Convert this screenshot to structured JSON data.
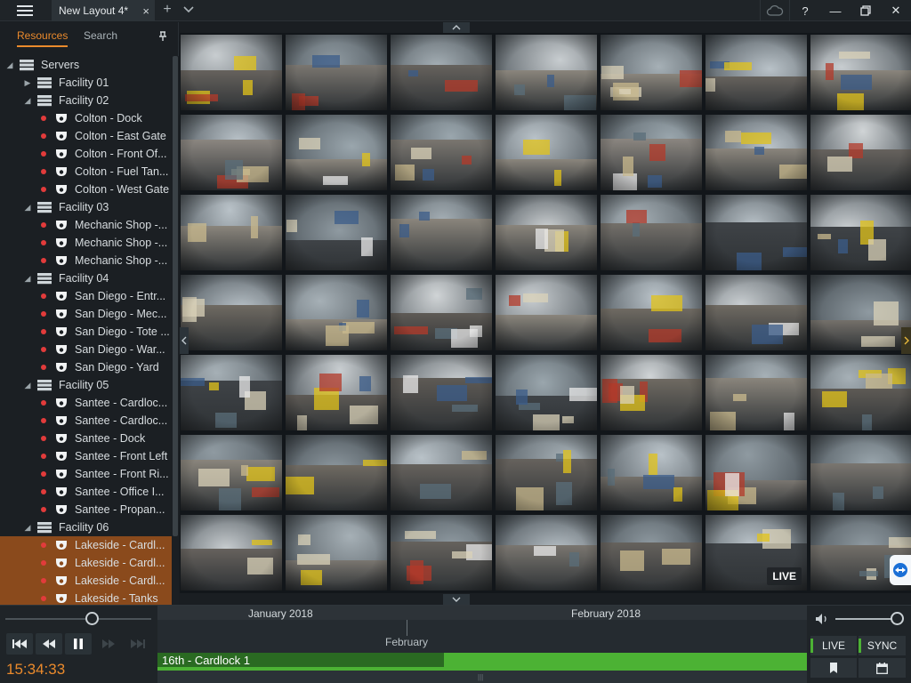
{
  "titlebar": {
    "tab_label": "New Layout 4*",
    "close_glyph": "×",
    "add_glyph": "+",
    "help_glyph": "?",
    "minimize_glyph": "—",
    "close_window_glyph": "✕"
  },
  "left_panel": {
    "tabs": {
      "resources": "Resources",
      "search": "Search"
    },
    "tree": [
      {
        "type": "root",
        "label": "Servers",
        "indent": 0,
        "expanded": true
      },
      {
        "type": "server",
        "label": "Facility 01",
        "expanded": false
      },
      {
        "type": "server",
        "label": "Facility 02",
        "expanded": true
      },
      {
        "type": "camera",
        "label": "Colton - Dock"
      },
      {
        "type": "camera",
        "label": "Colton - East Gate"
      },
      {
        "type": "camera",
        "label": "Colton - Front Of..."
      },
      {
        "type": "camera",
        "label": "Colton - Fuel Tan..."
      },
      {
        "type": "camera",
        "label": "Colton - West Gate"
      },
      {
        "type": "server",
        "label": "Facility 03",
        "expanded": true
      },
      {
        "type": "camera",
        "label": "Mechanic Shop -..."
      },
      {
        "type": "camera",
        "label": "Mechanic Shop -..."
      },
      {
        "type": "camera",
        "label": "Mechanic Shop -..."
      },
      {
        "type": "server",
        "label": "Facility 04",
        "expanded": true
      },
      {
        "type": "camera",
        "label": "San Diego - Entr..."
      },
      {
        "type": "camera",
        "label": "San Diego - Mec..."
      },
      {
        "type": "camera",
        "label": "San Diego - Tote ..."
      },
      {
        "type": "camera",
        "label": "San Diego - War..."
      },
      {
        "type": "camera",
        "label": "San Diego - Yard"
      },
      {
        "type": "server",
        "label": "Facility 05",
        "expanded": true
      },
      {
        "type": "camera",
        "label": "Santee - Cardloc..."
      },
      {
        "type": "camera",
        "label": "Santee - Cardloc..."
      },
      {
        "type": "camera",
        "label": "Santee - Dock"
      },
      {
        "type": "camera",
        "label": "Santee - Front Left"
      },
      {
        "type": "camera",
        "label": "Santee - Front Ri..."
      },
      {
        "type": "camera",
        "label": "Santee - Office I..."
      },
      {
        "type": "camera",
        "label": "Santee - Propan..."
      },
      {
        "type": "server",
        "label": "Facility 06",
        "expanded": true
      },
      {
        "type": "camera",
        "label": "Lakeside - Cardl...",
        "selected": true
      },
      {
        "type": "camera",
        "label": "Lakeside - Cardl...",
        "selected": true
      },
      {
        "type": "camera",
        "label": "Lakeside - Cardl...",
        "selected": true
      },
      {
        "type": "camera",
        "label": "Lakeside - Tanks",
        "selected": true
      }
    ]
  },
  "grid": {
    "live_badge": "LIVE"
  },
  "playback": {
    "time": "15:34:33"
  },
  "timeline": {
    "month_left": "January 2018",
    "month_right": "February 2018",
    "zoom_label": "February",
    "bar_label": "16th - Cardlock 1"
  },
  "controls": {
    "live_label": "LIVE",
    "sync_label": "SYNC"
  },
  "colors": {
    "accent": "#ea8a2c",
    "live_green": "#4cb234",
    "recording_dot": "#e23b3b",
    "selection": "#8a4a1c"
  }
}
